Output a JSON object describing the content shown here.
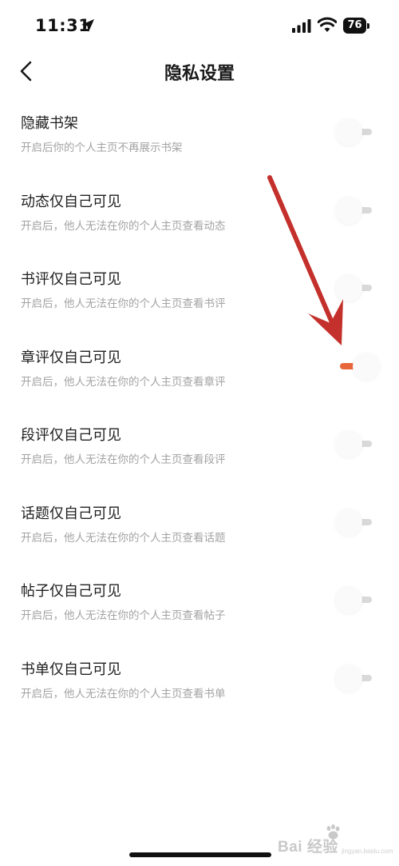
{
  "status_bar": {
    "time": "11:31",
    "battery": "76"
  },
  "header": {
    "title": "隐私设置"
  },
  "settings": [
    {
      "title": "隐藏书架",
      "description": "开启后你的个人主页不再展示书架",
      "enabled": false
    },
    {
      "title": "动态仅自己可见",
      "description": "开启后，他人无法在你的个人主页查看动态",
      "enabled": false
    },
    {
      "title": "书评仅自己可见",
      "description": "开启后，他人无法在你的个人主页查看书评",
      "enabled": false
    },
    {
      "title": "章评仅自己可见",
      "description": "开启后，他人无法在你的个人主页查看章评",
      "enabled": true
    },
    {
      "title": "段评仅自己可见",
      "description": "开启后，他人无法在你的个人主页查看段评",
      "enabled": false
    },
    {
      "title": "话题仅自己可见",
      "description": "开启后，他人无法在你的个人主页查看话题",
      "enabled": false
    },
    {
      "title": "帖子仅自己可见",
      "description": "开启后，他人无法在你的个人主页查看帖子",
      "enabled": false
    },
    {
      "title": "书单仅自己可见",
      "description": "开启后，他人无法在你的个人主页查看书单",
      "enabled": false
    }
  ],
  "colors": {
    "toggle_on": "#e8673a",
    "toggle_off": "#d9d9d9",
    "annotation_arrow": "#c4302b"
  },
  "watermark": {
    "text": "Bai 经验",
    "sub": "jingyan.baidu.com"
  }
}
